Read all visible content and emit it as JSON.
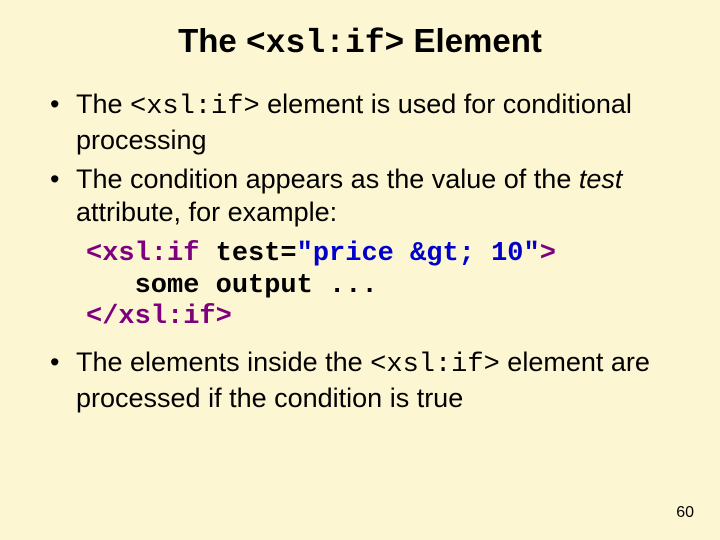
{
  "title": {
    "pre": "The ",
    "code": "<xsl:if>",
    "post": " Element"
  },
  "bullets": {
    "b1": {
      "pre": "The ",
      "code": "<xsl:if>",
      "post": " element is used for conditional processing"
    },
    "b2": {
      "pre": "The condition appears as the value of the ",
      "ital": "test",
      "post": " attribute, for example:"
    },
    "b3": {
      "pre": "The elements inside the ",
      "code": "<xsl:if>",
      "post": " element are processed if the condition is true"
    }
  },
  "code": {
    "open_tag1": "<xsl:if ",
    "attr": "test=",
    "val": "\"price &gt; 10\"",
    "open_tag2": ">",
    "body": "   some output ...",
    "close": "</xsl:if>"
  },
  "page_number": "60"
}
